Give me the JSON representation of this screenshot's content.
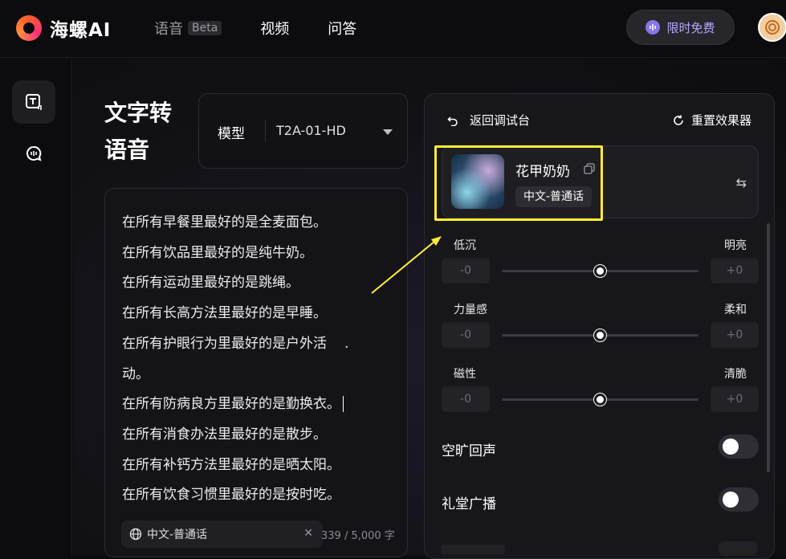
{
  "app": {
    "name": "海螺AI"
  },
  "nav": {
    "items": [
      {
        "label": "语音",
        "badge": "Beta"
      },
      {
        "label": "视频"
      },
      {
        "label": "问答"
      }
    ],
    "free_label": "限时免费"
  },
  "page": {
    "title": "文字转语音"
  },
  "model": {
    "label": "模型",
    "value": "T2A-01-HD"
  },
  "editor": {
    "lines": [
      "在所有早餐里最好的是全麦面包。",
      "在所有饮品里最好的是纯牛奶。",
      "在所有运动里最好的是跳绳。",
      "在所有长高方法里最好的是早睡。",
      "在所有护眼行为里最好的是户外活",
      "动。",
      "在所有防病良方里最好的是勤换衣。",
      "在所有消食办法里最好的是散步。",
      "在所有补钙方法里最好的是晒太阳。",
      "在所有饮食习惯里最好的是按时吃。"
    ],
    "stray_mark": ".",
    "language": "中文-普通话",
    "char_count": "339 / 5,000 字"
  },
  "panel": {
    "back_label": "返回调试台",
    "reset_label": "重置效果器",
    "voice": {
      "name": "花甲奶奶",
      "tag": "中文-普通话"
    },
    "sliders": [
      {
        "left": "低沉",
        "right": "明亮",
        "left_value": "-0",
        "right_value": "+0",
        "position": 0.5
      },
      {
        "left": "力量感",
        "right": "柔和",
        "left_value": "-0",
        "right_value": "+0",
        "position": 0.5
      },
      {
        "left": "磁性",
        "right": "清脆",
        "left_value": "-0",
        "right_value": "+0",
        "position": 0.5
      }
    ],
    "toggles": [
      {
        "label": "空旷回声",
        "on": false
      },
      {
        "label": "礼堂广播",
        "on": false
      }
    ]
  },
  "colors": {
    "accent": "#b9a8ff",
    "highlight": "#ffee33",
    "brand": "#ff5a2c"
  }
}
